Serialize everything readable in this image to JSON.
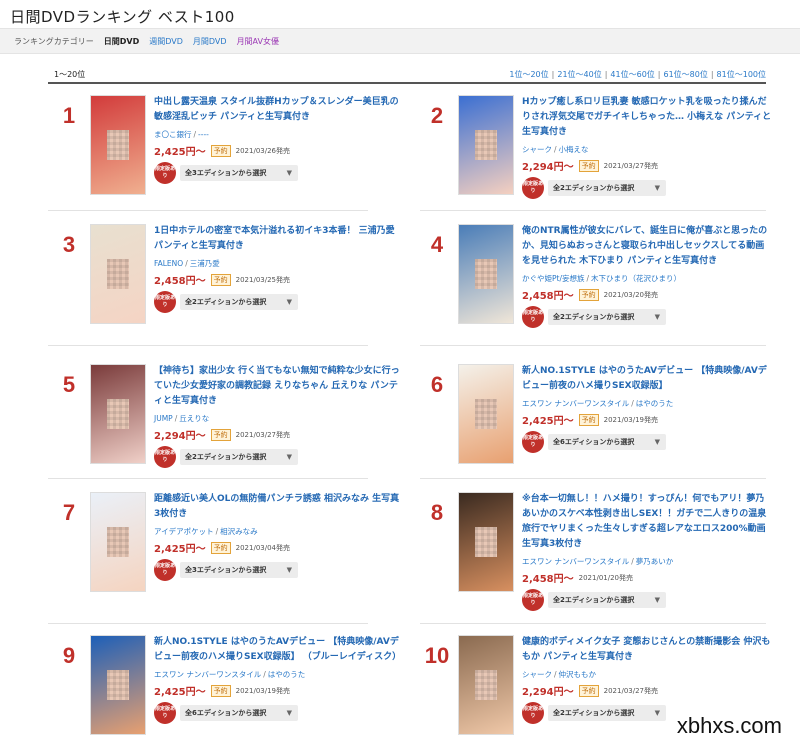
{
  "page": {
    "title": "日間DVDランキング ベスト100"
  },
  "categories": {
    "label": "ランキングカテゴリー",
    "items": [
      {
        "label": "日間DVD",
        "active": true
      },
      {
        "label": "週間DVD",
        "active": false
      },
      {
        "label": "月間DVD",
        "active": false
      },
      {
        "label": "月間AV女優",
        "active": false
      }
    ]
  },
  "range": {
    "current": "1〜20位",
    "pages": [
      "1位〜20位",
      "21位〜40位",
      "41位〜60位",
      "61位〜80位",
      "81位〜100位"
    ]
  },
  "items": [
    {
      "rank": "1",
      "title": "中出し露天温泉 スタイル抜群Hカップ＆スレンダー美巨乳の敏感淫乱ビッチ パンティと生写真付き",
      "maker": "ま〇こ銀行",
      "performer": "----",
      "price": "2,425円〜",
      "yoyaku": "予約",
      "release": "2021/03/26発売",
      "badge": "限定版あり",
      "select": "全3エディションから選択",
      "colors": [
        "#d23b3b",
        "#f0b090"
      ]
    },
    {
      "rank": "2",
      "title": "Hカップ癒し系ロリ巨乳妻 敏感ロケット乳を吸ったり揉んだりされ浮気交尾でガチイキしちゃった… 小梅えな パンティと生写真付き",
      "maker": "シャーク",
      "performer": "小梅えな",
      "price": "2,294円〜",
      "yoyaku": "予約",
      "release": "2021/03/27発売",
      "badge": "限定版あり",
      "select": "全2エディションから選択",
      "colors": [
        "#3b6fd2",
        "#f5d0c0"
      ]
    },
    {
      "rank": "3",
      "title": "1日中ホテルの密室で本気汁溢れる初イキ3本番！ 三浦乃愛 パンティと生写真付き",
      "maker": "FALENO",
      "performer": "三浦乃愛",
      "price": "2,458円〜",
      "yoyaku": "予約",
      "release": "2021/03/25発売",
      "badge": "限定版あり",
      "select": "全2エディションから選択",
      "colors": [
        "#e8e0d0",
        "#f5d4c4"
      ]
    },
    {
      "rank": "4",
      "title": "俺のNTR属性が彼女にバレて、誕生日に俺が喜ぶと思ったのか、見知らぬおっさんと寝取られ中出しセックスしてる動画を見せられた 木下ひまり パンティと生写真付き",
      "maker": "かぐや姫Pt/妄想族",
      "performer": "木下ひまり（花沢ひまり）",
      "price": "2,458円〜",
      "yoyaku": "予約",
      "release": "2021/03/20発売",
      "badge": "限定版あり",
      "select": "全2エディションから選択",
      "colors": [
        "#4a7db8",
        "#f0e6d8"
      ]
    },
    {
      "rank": "5",
      "title": "【神待ち】家出少女 行く当てもない無知で純粋な少女に行っていた少女愛好家の調教記録 えりなちゃん 丘えりな パンティと生写真付き",
      "maker": "JUMP",
      "performer": "丘えりな",
      "price": "2,294円〜",
      "yoyaku": "予約",
      "release": "2021/03/27発売",
      "badge": "限定版あり",
      "select": "全2エディションから選択",
      "colors": [
        "#7a3b3b",
        "#f0d0c8"
      ]
    },
    {
      "rank": "6",
      "title": "新人NO.1STYLE はやのうたAVデビュー 【特典映像/AVデビュー前夜のハメ撮りSEX収録版】",
      "maker": "エスワン ナンバーワンスタイル",
      "performer": "はやのうた",
      "price": "2,425円〜",
      "yoyaku": "予約",
      "release": "2021/03/19発売",
      "badge": "限定版あり",
      "select": "全6エディションから選択",
      "colors": [
        "#f4f1ea",
        "#e8a070"
      ]
    },
    {
      "rank": "7",
      "title": "距離感近い美人OLの無防備パンチラ誘惑 相沢みなみ 生写真3枚付き",
      "maker": "アイデアポケット",
      "performer": "相沢みなみ",
      "price": "2,425円〜",
      "yoyaku": "予約",
      "release": "2021/03/04発売",
      "badge": "限定版あり",
      "select": "全3エディションから選択",
      "colors": [
        "#eaf0f8",
        "#f5d4c0"
      ]
    },
    {
      "rank": "8",
      "title": "※台本一切無し！！ハメ撮り！すっぴん！何でもアリ！夢乃あいかのスケベ本性剥き出しSEX！！ガチで二人きりの温泉旅行でヤリまくった生々しすぎる超レアなエロス200%動画 生写真3枚付き",
      "maker": "エスワン ナンバーワンスタイル",
      "performer": "夢乃あいか",
      "price": "2,458円〜",
      "yoyaku": "",
      "release": "2021/01/20発売",
      "badge": "限定版あり",
      "select": "全2エディションから選択",
      "colors": [
        "#3a2a20",
        "#d89060"
      ]
    },
    {
      "rank": "9",
      "title": "新人NO.1STYLE はやのうたAVデビュー 【特典映像/AVデビュー前夜のハメ撮りSEX収録版】 （ブルーレイディスク）",
      "maker": "エスワン ナンバーワンスタイル",
      "performer": "はやのうた",
      "price": "2,425円〜",
      "yoyaku": "予約",
      "release": "2021/03/19発売",
      "badge": "限定版あり",
      "select": "全6エディションから選択",
      "colors": [
        "#1d5fb8",
        "#e8a070"
      ]
    },
    {
      "rank": "10",
      "title": "健康的ボディメイク女子 変態おじさんとの禁断撮影会 仲沢ももか パンティと生写真付き",
      "maker": "シャーク",
      "performer": "仲沢ももか",
      "price": "2,294円〜",
      "yoyaku": "予約",
      "release": "2021/03/27発売",
      "badge": "限定版あり",
      "select": "全2エディションから選択",
      "colors": [
        "#8a6a50",
        "#f0c8a8"
      ]
    }
  ],
  "watermark": "xbhxs.com"
}
